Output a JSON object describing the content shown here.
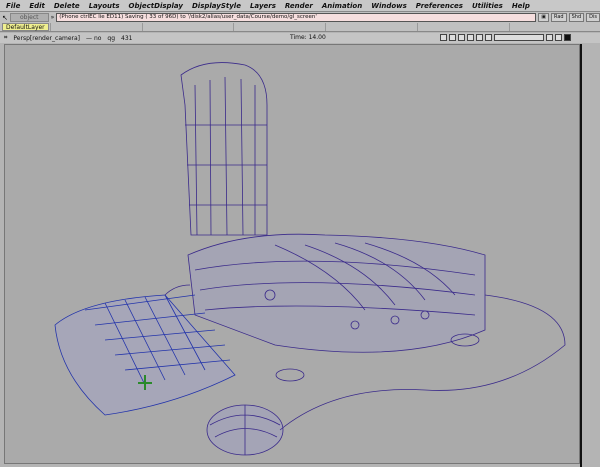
{
  "menu": [
    "File",
    "Edit",
    "Delete",
    "Layouts",
    "ObjectDisplay",
    "DisplayStyle",
    "Layers",
    "Render",
    "Animation",
    "Windows",
    "Preferences",
    "Utilities",
    "Help"
  ],
  "object_field": "object",
  "command_line": "(Phone ctrlEC lie ED11) Saving ( 33 of 96D) to '/disk2/alias/user_data/Course/demo/gl_screen'",
  "side_buttons": [
    "Rad",
    "Shd",
    "Dis"
  ],
  "layer": "DefaultLayer",
  "panel": {
    "camera": "Persp[render_camera]",
    "fields": [
      "— no",
      "qg",
      "431"
    ],
    "time": "Time: 14.00"
  },
  "colors": {
    "viewport": "#aaaaaa",
    "wire": "#3a2a8a",
    "wire_blue": "#2233aa",
    "command_bg": "#f6dede",
    "layer_bg": "#f0f090"
  }
}
